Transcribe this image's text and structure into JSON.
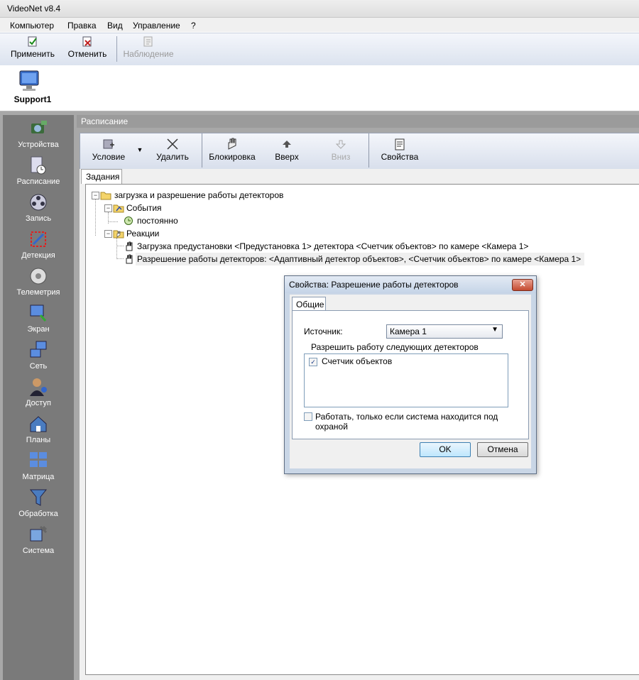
{
  "window": {
    "title": "VideoNet v8.4"
  },
  "menu": [
    "Компьютер",
    "Правка",
    "Вид",
    "Управление",
    "?"
  ],
  "toolbar": {
    "apply": "Применить",
    "cancel": "Отменить",
    "observe": "Наблюдение"
  },
  "computer": {
    "name": "Support1"
  },
  "nav": [
    "Устройства",
    "Расписание",
    "Запись",
    "Детекция",
    "Телеметрия",
    "Экран",
    "Сеть",
    "Доступ",
    "Планы",
    "Матрица",
    "Обработка",
    "Система"
  ],
  "schedule": {
    "header": "Расписание",
    "toolbar": {
      "condition": "Условие",
      "delete": "Удалить",
      "block": "Блокировка",
      "up": "Вверх",
      "down": "Вниз",
      "properties": "Свойства"
    },
    "tab": "Задания",
    "tree": {
      "root": "загрузка и разрешение работы детекторов",
      "events": "События",
      "event_item": "постоянно",
      "reactions": "Реакции",
      "reaction1": "Загрузка предустановки <Предустановка 1> детектора <Счетчик объектов> по камере <Камера 1>",
      "reaction2": "Разрешение работы детекторов: <Адаптивный детектор объектов>, <Счетчик объектов> по камере <Камера 1>"
    }
  },
  "dialog": {
    "title": "Свойства: Разрешение работы детекторов",
    "tab": "Общие",
    "source_label": "Источник:",
    "source_value": "Камера 1",
    "allow_label": "Разрешить работу следующих детекторов",
    "detectors": [
      {
        "name": "Счетчик объектов",
        "checked": true
      }
    ],
    "armed_only_label": "Работать, только если система находится под охраной",
    "armed_only_checked": false,
    "ok": "OK",
    "cancel": "Отмена"
  }
}
